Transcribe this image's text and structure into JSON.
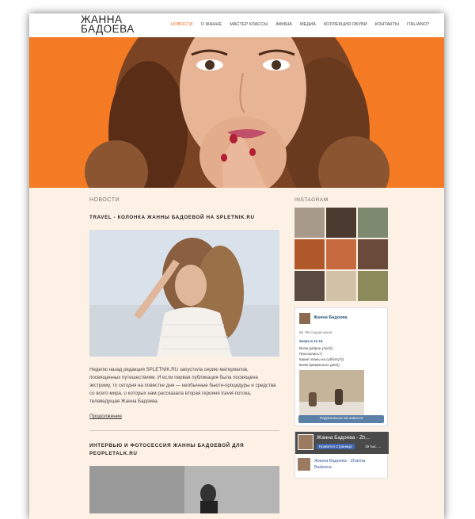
{
  "brand": {
    "line1": "ЖАННА",
    "line2": "БАДОЕВА"
  },
  "nav": [
    {
      "label": "НОВОСТИ",
      "active": true
    },
    {
      "label": "О ЖАННЕ",
      "active": false
    },
    {
      "label": "МАСТЕР КЛАССЫ",
      "active": false
    },
    {
      "label": "АФИША",
      "active": false
    },
    {
      "label": "МЕДИА",
      "active": false
    },
    {
      "label": "КОЛЛЕКЦИЯ ОБУВИ",
      "active": false
    },
    {
      "label": "КОНТАКТЫ",
      "active": false
    },
    {
      "label": "ITALIANO?",
      "active": false
    }
  ],
  "colors": {
    "accent": "#f06a1c",
    "hero_bg": "#f47a24",
    "page_bg": "#fdf1e6",
    "vk_button": "#5b7fa6"
  },
  "main": {
    "section_title": "НОВОСТИ",
    "post1": {
      "title": "TRAVEL - КОЛОНКА ЖАННЫ БАДОЕВОЙ НА SPLETNIK.RU",
      "excerpt": "Неделю назад редакция SPLETNIK.RU запустила серию материалов, посвященных путешествиям. И если первая публикация была посвящена экстриму, то сегодня на повестке дня — необычные бьюти-процедуры и средства со всего мира, о которых нам рассказала вторая героиня travel-потока, телеведущая Жанна Бадоева.",
      "more": "Продолжение"
    },
    "post2": {
      "title": "ИНТЕРВЬЮ И ФОТОСЕССИЯ ЖАННЫ БАДОЕВОЙ ДЛЯ PEOPLETALK.RU"
    }
  },
  "sidebar": {
    "instagram_title": "INSTAGRAM",
    "vk": {
      "name": "Жанна Бадоева",
      "subscribers": "86 786 подписчиков",
      "post_time": "вчера в 11:14",
      "post_text": [
        "Всем доброе утро!))",
        "Проснулись?)",
        "Какие планы на субботу?))",
        "Всем прекрасного дня!))"
      ],
      "subscribe": "Подписаться на новости"
    },
    "fb": {
      "page_title": "Жанна Бадоева - Zh...",
      "like_label": "Нравится Страница",
      "like_count": "19 тыс. ...",
      "name": "Жанна Бадоева - Zhanna Badoeva"
    }
  }
}
